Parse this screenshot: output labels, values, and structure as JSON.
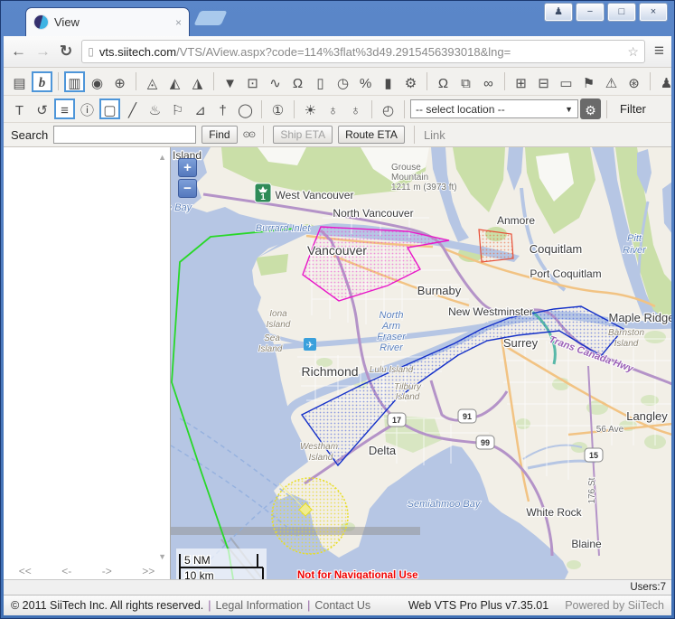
{
  "browser": {
    "tab_title": "View",
    "tab_close": "×",
    "controls": {
      "profile": "♟",
      "minimize": "−",
      "maximize": "□",
      "close": "×"
    },
    "nav": {
      "back": "←",
      "forward": "→",
      "refresh": "↻",
      "doc": "▯",
      "star": "☆",
      "menu": "≡"
    },
    "url_domain": "vts.siitech.com",
    "url_path": "/VTS/AView.aspx?code=114%3flat%3d49.2915456393018&lng="
  },
  "toolbar1": {
    "items": [
      "▤",
      "b",
      "▥",
      "◉",
      "⊕",
      "◬",
      "◭",
      "◮",
      "▼",
      "⊡",
      "∿",
      "Ω",
      "▯",
      "◷",
      "%",
      "▮",
      "⚙",
      "Ω",
      "⧉",
      "∞",
      "⊞",
      "⊟",
      "▭",
      "⚑",
      "⚠",
      "⊛",
      "♟"
    ]
  },
  "toolbar2": {
    "items": [
      "T",
      "↺",
      "≡",
      "ⓘ",
      "▢",
      "╱",
      "♨",
      "⚐",
      "⊿",
      "†",
      "◯",
      "①",
      "☀",
      "♁",
      "♁",
      "◴"
    ],
    "location_value": "-- select location --",
    "caret": "▼",
    "gear": "⚙",
    "filter_label": "Filter"
  },
  "search": {
    "label": "Search",
    "find": "Find",
    "binoculars": "⊙⊙",
    "ship_eta": "Ship ETA",
    "route_eta": "Route ETA",
    "link": "Link"
  },
  "map": {
    "zoom_in": "+",
    "zoom_out": "−",
    "labels": [
      "owen Island",
      "hoe Bay",
      "West Vancouver",
      "North Vancouver",
      "Grouse",
      "Mountain",
      "1211 m (3973 ft)",
      "Anmore",
      "Coquitlam",
      "Port Coquitlam",
      "Pitt",
      "River",
      "Burrard Inlet",
      "Vancouver",
      "Burnaby",
      "New Westminster",
      "Maple Ridge",
      "North",
      "Arm",
      "Fraser",
      "River",
      "Iona",
      "Island",
      "Sea",
      "Island",
      "Surrey",
      "Barnston",
      "Island",
      "Trans Canada Hwy",
      "Richmond",
      "Lulu Island",
      "Tilbury",
      "Island",
      "Westham",
      "Island",
      "Delta",
      "Langley",
      "56 Ave",
      "176 St",
      "Semiahmoo Bay",
      "White Rock",
      "Blaine"
    ],
    "shields": {
      "tc": "1",
      "s17": "17",
      "s91": "91",
      "s99": "99",
      "s15": "15"
    },
    "airport": "✈",
    "scale": {
      "nm": "5 NM",
      "km": "10 km"
    },
    "disclaimer": "Not for Navigational Use",
    "colors": {
      "water": "#b6c6e4",
      "land": "#f2efe7",
      "magenta_zone": "#e818c8",
      "blue_zone": "#1430c8",
      "red_zone": "#e85038",
      "yellow_zone": "#e8de20",
      "green_route": "#28d828"
    }
  },
  "panel": {
    "scroll_up": "▲",
    "scroll_down": "▼",
    "pagination": [
      "<<",
      "<-",
      "->",
      ">>"
    ]
  },
  "statusbar": {
    "users": "Users:7"
  },
  "footer": {
    "copyright": "© 2011 SiiTech Inc. All rights reserved.",
    "pipe": "|",
    "legal": "Legal Information",
    "contact": "Contact Us",
    "product": "Web VTS Pro Plus v7.35.01",
    "powered": "Powered by SiiTech"
  }
}
